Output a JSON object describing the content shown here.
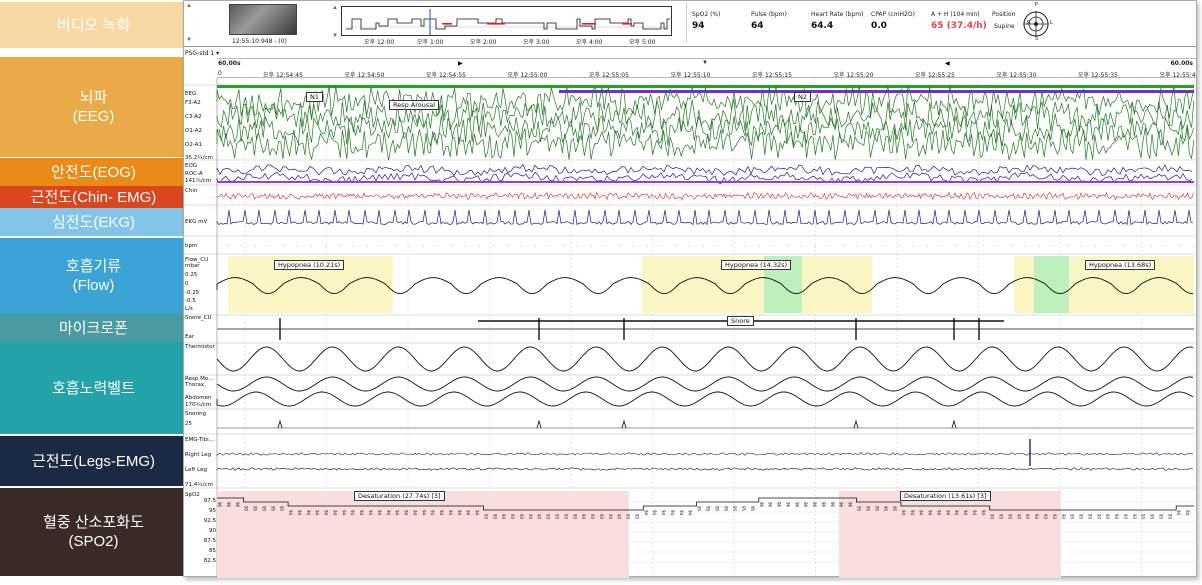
{
  "labels": [
    {
      "text": "비디오 녹화",
      "name": "label-video",
      "color": "#f8d9a3"
    },
    {
      "text": "뇌파\n(EEG)",
      "name": "label-eeg",
      "color": "#e9aa47"
    },
    {
      "text": "안전도(EOG)",
      "name": "label-eog",
      "color": "#ea8a17"
    },
    {
      "text": "근전도(Chin- EMG)",
      "name": "label-chin-emg",
      "color": "#d94620"
    },
    {
      "text": "심전도(EKG)",
      "name": "label-ekg",
      "color": "#82c5e8"
    },
    {
      "text": "호흡기류\n(Flow)",
      "name": "label-flow",
      "color": "#3ba3d6"
    },
    {
      "text": "마이크로폰",
      "name": "label-microphone",
      "color": "#4a9aa4"
    },
    {
      "text": "호흡노력벨트",
      "name": "label-effort-belt",
      "color": "#22a3a9"
    },
    {
      "text": "근전도(Legs-EMG)",
      "name": "label-legs-emg",
      "color": "#1a2a44"
    },
    {
      "text": "혈중 산소포화도\n(SPO2)",
      "name": "label-spo2",
      "color": "#3a2a26"
    }
  ],
  "video": {
    "timestamp": "12:55:10:948 - (0)"
  },
  "overview": {
    "ticks": [
      "오후 12:00",
      "오후 1:00",
      "오후 2:00",
      "오후 3:00",
      "오후 4:00",
      "오후 5:00"
    ]
  },
  "vitals": [
    {
      "label": "SpO2 (%)",
      "value": "94"
    },
    {
      "label": "Pulse (bpm)",
      "value": "64"
    },
    {
      "label": "Heart Rate (bpm)",
      "value": "64.4"
    },
    {
      "label": "CPAP (cmH2O)",
      "value": "0.0"
    },
    {
      "label": "A + H (104 min)",
      "value": "65 (37.4/h)",
      "alert": true
    }
  ],
  "position": {
    "label": "Position",
    "value": "Supine",
    "compass": [
      "P",
      "R",
      "L",
      "S"
    ]
  },
  "montage": {
    "selected": "PSG-std 1"
  },
  "timeline": {
    "epoch_left": "60.00s",
    "epoch_right": "60.00s",
    "start": "0",
    "ticks": [
      "오후 12:54:45",
      "오후 12:54:50",
      "오후 12:54:55",
      "오후 12:55:00",
      "오후 12:55:05",
      "오후 12:55:10",
      "오후 12:55:15",
      "오후 12:55:20",
      "오후 12:55:25",
      "오후 12:55:30",
      "오후 12:55:35",
      "오후 12:55:4"
    ]
  },
  "channels": {
    "eeg_group": "EEG",
    "eeg": [
      "F3-A2",
      "C3-A2",
      "O1-A2",
      "O2-A1"
    ],
    "eeg_scale": "35.2¾/cm",
    "eog": "EOG",
    "eog_scale": "141¾/cm",
    "eog_leads": "ROC-A",
    "chin": "Chin",
    "ekg": "EKG mV",
    "bpm": "bpm",
    "flow": "Flow_CU",
    "flow_unit": "mbar",
    "flow_ticks": [
      "0.25",
      "0",
      "-0.25",
      "-0.5"
    ],
    "flow_scale": "L/s",
    "snore": "Snore_CU",
    "snore_sub": "Ear",
    "thermistor": "Thermistor",
    "effort": "Resp Mo...",
    "thorax": "Thorax",
    "abdomen": "Abdomen",
    "effort_scale": "170¾/cm",
    "snoring": "Snoring",
    "snoring_val": "25",
    "emg_tib": "EMG-Tibi...",
    "right_leg": "Right Leg",
    "left_leg": "Left Leg",
    "legs_scale": "71.4¾/cm",
    "spo2": "SpO2",
    "spo2_ticks": [
      "97.5",
      "95",
      "92.5",
      "90",
      "87.5",
      "85",
      "82.5"
    ]
  },
  "annotations": {
    "n1": "N1",
    "n2": "N2",
    "resp_arousal": "Resp Arousal",
    "hypopneas": [
      "Hypopnea (10.21s)",
      "Hypopnea (14.32s)",
      "Hypopnea (13.68s)"
    ],
    "snore": "Snore",
    "desaturations": [
      "Desaturation (27.74s) [3]",
      "Desaturation (13.61s) [3]"
    ]
  },
  "spo2_values": [
    "96",
    "96",
    "96",
    "95",
    "95",
    "95",
    "95",
    "95",
    "94",
    "94",
    "94",
    "94",
    "94",
    "94",
    "94",
    "94",
    "94",
    "94",
    "94",
    "94",
    "94",
    "94",
    "94",
    "94",
    "94",
    "94",
    "94",
    "94",
    "94",
    "94",
    "93",
    "93",
    "93",
    "93",
    "93",
    "93",
    "93",
    "93",
    "93",
    "93",
    "93",
    "93",
    "93",
    "93",
    "93",
    "93",
    "93",
    "93",
    "94",
    "94",
    "94",
    "94",
    "94",
    "94",
    "95",
    "95",
    "95",
    "95",
    "95",
    "95",
    "95",
    "96",
    "96",
    "96",
    "96",
    "96",
    "96",
    "96",
    "96",
    "96",
    "96",
    "96",
    "95",
    "95",
    "95",
    "95",
    "95",
    "94",
    "94",
    "94",
    "94",
    "94",
    "94",
    "94",
    "94",
    "94",
    "94",
    "93",
    "93",
    "93",
    "93",
    "93",
    "93",
    "93",
    "93",
    "93",
    "93",
    "93",
    "93",
    "93",
    "93",
    "93",
    "93",
    "93",
    "93",
    "93",
    "93",
    "93",
    "94",
    "94"
  ]
}
